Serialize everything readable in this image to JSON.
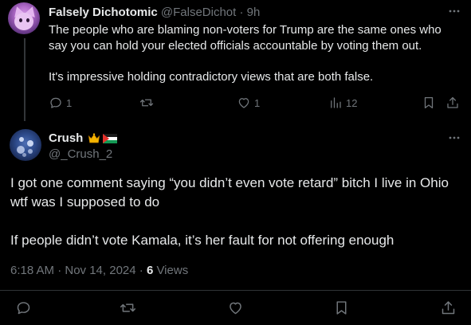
{
  "parent_tweet": {
    "display_name": "Falsely Dichotomic",
    "handle": "@FalseDichot",
    "separator": "·",
    "time": "9h",
    "paragraph_1": "The people who are blaming non-voters for Trump are the same ones who say you can hold your elected officials accountable by voting them out.",
    "paragraph_2": "It's impressive holding contradictory views that are both false.",
    "reply_count": "1",
    "retweet_count": "",
    "like_count": "1",
    "view_count": "12",
    "more_icon": "more-dots-icon"
  },
  "main_tweet": {
    "display_name": "Crush",
    "badges": [
      "crown-emoji-icon",
      "palestine-flag-icon"
    ],
    "handle": "@_Crush_2",
    "paragraph_1": "I got one comment saying “you didn’t even vote retard” bitch I live in Ohio wtf was I supposed to do",
    "paragraph_2": "If people didn’t vote Kamala, it’s her fault for not offering enough",
    "timestamp": "6:18 AM · Nov 14, 2024 ·",
    "views_count": "6",
    "views_label": "Views",
    "more_icon": "more-dots-icon"
  },
  "colors": {
    "background": "#000000",
    "text_primary": "#e7e9ea",
    "text_secondary": "#71767b",
    "divider": "#2f3336"
  }
}
